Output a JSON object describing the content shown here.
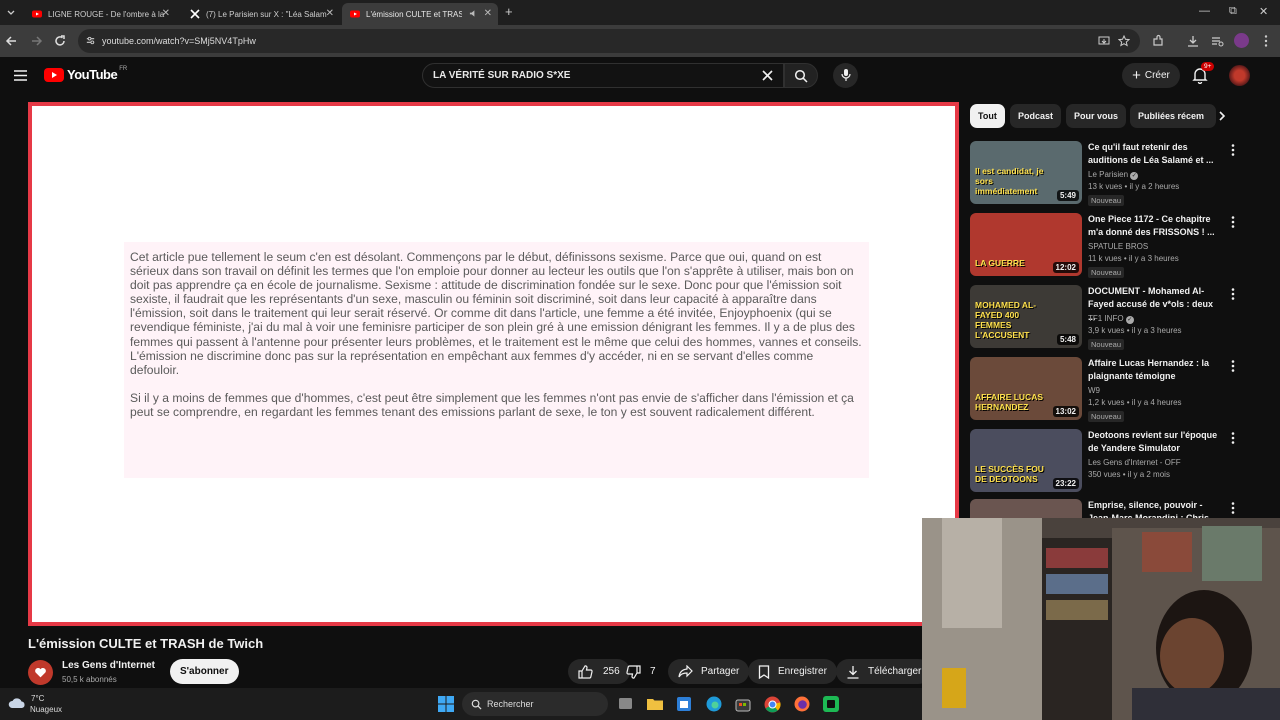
{
  "browser": {
    "tabs": [
      {
        "title": "LIGNE ROUGE - De l'ombre à la"
      },
      {
        "title": "(7) Le Parisien sur X : \"Léa Salam"
      },
      {
        "title": "L'émission CULTE et TRASH"
      }
    ],
    "new_tab": "+",
    "url": "youtube.com/watch?v=SMj5NV4TpHw"
  },
  "youtube": {
    "logo_text": "YouTube",
    "country": "FR",
    "search_value": "LA VÉRITÉ SUR RADIO S*XE",
    "create_label": "Créer",
    "notif_count": "9+"
  },
  "video": {
    "paragraph1": "Cet article pue tellement le seum c'en est désolant. Commençons par le début, définissons sexisme. Parce que oui, quand on est sérieux dans son travail on définit les termes que l'on emploie pour donner au lecteur les outils que l'on s'apprête à utiliser, mais bon on doit pas apprendre ça en école de journalisme. Sexisme : attitude de discrimination fondée sur le sexe. Donc pour que l'émission soit sexiste, il faudrait que les représentants d'un sexe, masculin ou féminin soit discriminé, soit dans leur capacité à apparaître dans l'émission, soit dans le traitement qui leur serait réservé. Or comme dit dans l'article, une femme a été invitée, Enjoyphoenix (qui se revendique féministe, j'ai du mal à voir une feminisre participer de son plein gré à une emission dénigrant les femmes. Il y a de plus des femmes qui passent à l'antenne pour présenter leurs problèmes, et le traitement est le même que celui des hommes, vannes et conseils. L'émission ne discrimine donc pas sur la représentation en empêchant aux femmes d'y accéder, ni en se servant d'elles comme defouloir.",
    "paragraph2": "Si il y a moins de femmes que d'hommes, c'est peut être simplement que les femmes n'ont pas envie de s'afficher dans l'émission et ça peut se comprendre, en regardant les femmes tenant des emissions parlant de sexe, le ton y est souvent radicalement différent.",
    "title": "L'émission CULTE et TRASH de Twich",
    "channel": "Les Gens d'Internet",
    "subscribers": "50,5 k abonnés",
    "subscribe_label": "S'abonner",
    "likes": "256",
    "dislikes": "7",
    "share_label": "Partager",
    "save_label": "Enregistrer",
    "download_label": "Télécharger"
  },
  "chips": [
    "Tout",
    "Podcast",
    "Pour vous",
    "Publiées récem"
  ],
  "recommendations": [
    {
      "title": "Ce qu'il faut retenir des auditions de Léa Salamé et ...",
      "channel": "Le Parisien",
      "verified": true,
      "meta": "13 k vues • il y a 2 heures",
      "badge": "Nouveau",
      "duration": "5:49",
      "thumb_text": "Il est candidat, je sors immédiatement",
      "thumb_color": "#5a6a6e"
    },
    {
      "title": "One Piece 1172 - Ce chapitre m'a donné des FRISSONS ! ...",
      "channel": "SPATULE BROS",
      "verified": false,
      "meta": "11 k vues • il y a 3 heures",
      "badge": "Nouveau",
      "duration": "12:02",
      "thumb_text": "LA GUERRE",
      "thumb_color": "#b0382e"
    },
    {
      "title": "DOCUMENT - Mohamed Al-Fayed accusé de v*ols : deux ...",
      "channel": "TF1 INFO",
      "verified": true,
      "meta": "3,9 k vues • il y a 3 heures",
      "badge": "Nouveau",
      "duration": "5:48",
      "thumb_text": "MOHAMED AL-FAYED 400 FEMMES L'ACCUSENT",
      "thumb_color": "#3d3a36"
    },
    {
      "title": "Affaire Lucas Hernandez : la plaignante témoigne",
      "channel": "W9",
      "verified": false,
      "meta": "1,2 k vues • il y a 4 heures",
      "badge": "Nouveau",
      "duration": "13:02",
      "thumb_text": "AFFAIRE LUCAS HERNANDEZ",
      "thumb_color": "#6b4a3a"
    },
    {
      "title": "Deotoons revient sur l'époque de Yandere Simulator",
      "channel": "Les Gens d'Internet - OFF",
      "verified": false,
      "meta": "350 vues • il y a 2 mois",
      "badge": "",
      "duration": "23:22",
      "thumb_text": "LE SUCCÈS FOU DE DEOTOONS",
      "thumb_color": "#4b4d5e"
    },
    {
      "title": "Emprise, silence, pouvoir - Jean-Marc Morandini : Chris",
      "channel": "",
      "verified": false,
      "meta": "",
      "badge": "",
      "duration": "",
      "thumb_text": "",
      "thumb_color": "#6a5550"
    }
  ],
  "taskbar": {
    "temperature": "7°C",
    "weather": "Nuageux",
    "search_placeholder": "Rechercher"
  },
  "colors": {
    "youtube_red": "#ff0000",
    "player_border": "#e63946",
    "text_card": "#fff3f8"
  }
}
